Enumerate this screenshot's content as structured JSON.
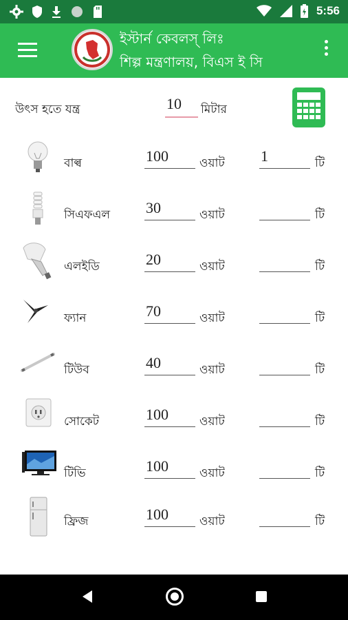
{
  "status_bar": {
    "time": "5:56"
  },
  "header": {
    "title": "ইস্টার্ন কেবলস্ লিঃ",
    "subtitle": "শিল্প মন্ত্রণালয়, বিএস ই সি"
  },
  "distance": {
    "label": "উৎস হতে যন্ত্র",
    "value": "10",
    "unit": "মিটার"
  },
  "appliances": [
    {
      "name": "বাল্ব",
      "watt": "100",
      "qty": "1"
    },
    {
      "name": "সিএফএল",
      "watt": "30",
      "qty": ""
    },
    {
      "name": "এলইডি",
      "watt": "20",
      "qty": ""
    },
    {
      "name": "ফ্যান",
      "watt": "70",
      "qty": ""
    },
    {
      "name": "টিউব",
      "watt": "40",
      "qty": ""
    },
    {
      "name": "সোকেট",
      "watt": "100",
      "qty": ""
    },
    {
      "name": "টিভি",
      "watt": "100",
      "qty": ""
    },
    {
      "name": "ফ্রিজ",
      "watt": "100",
      "qty": ""
    }
  ],
  "labels": {
    "watt_unit": "ওয়াট",
    "qty_unit": "টি"
  },
  "colors": {
    "status_bar": "#1a7a3c",
    "app_bar": "#2fbb54",
    "accent_underline": "#e79aa8"
  }
}
